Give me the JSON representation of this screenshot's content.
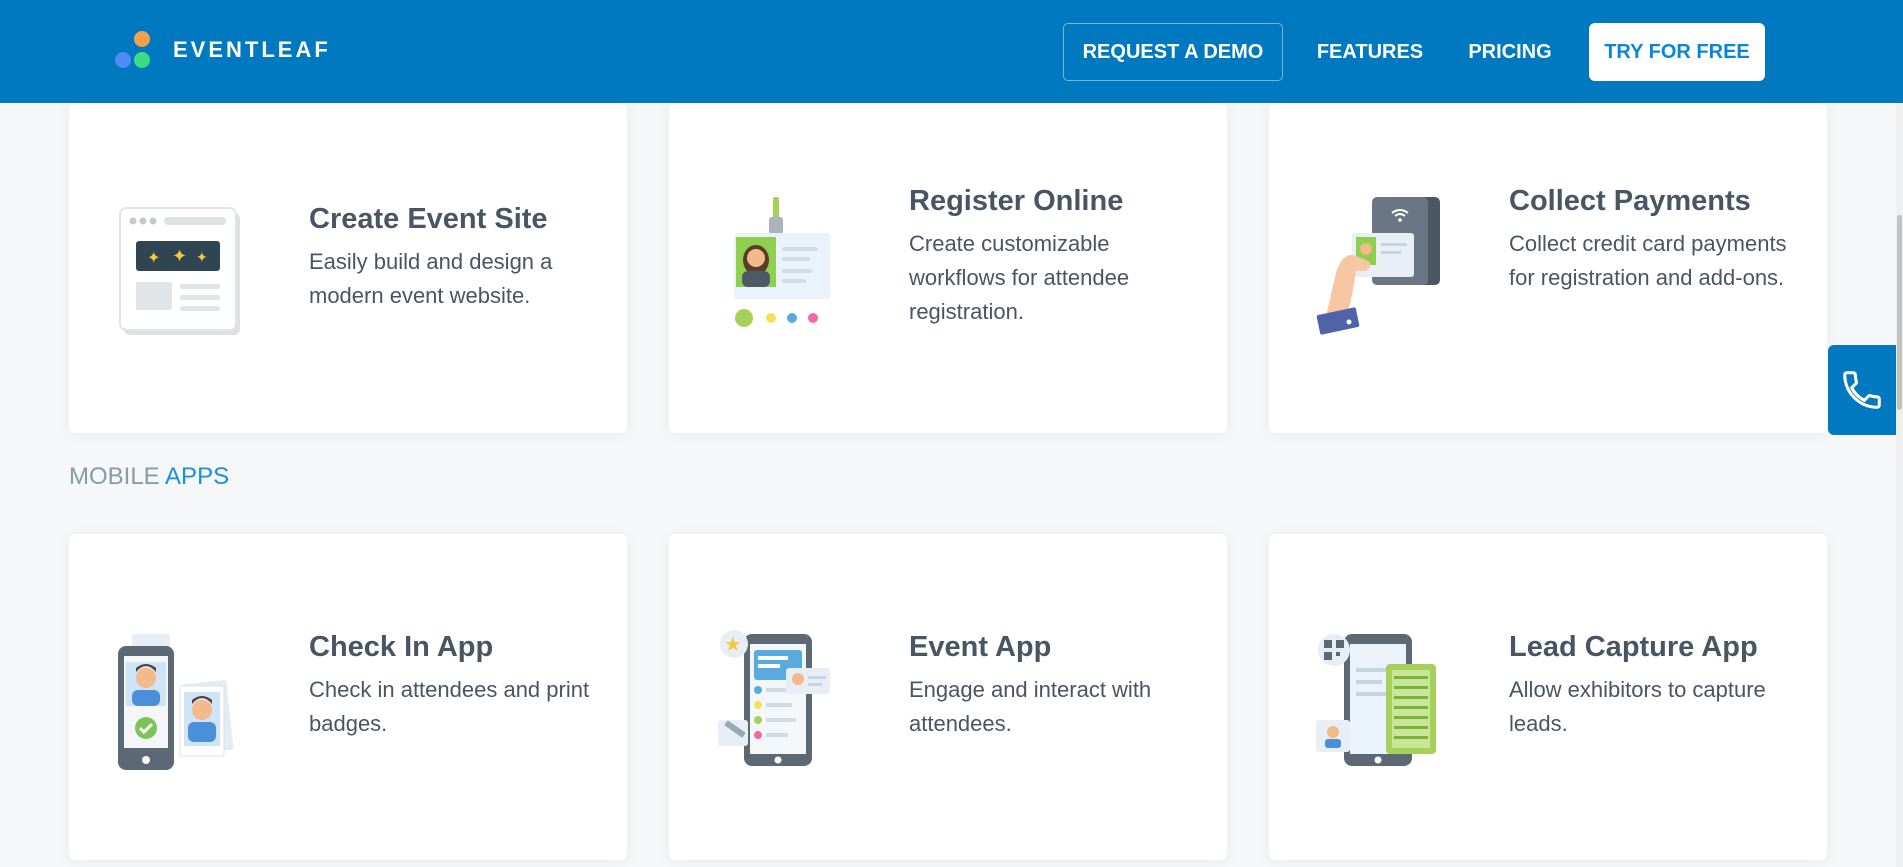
{
  "header": {
    "brand": "EVENTLEAF",
    "nav": {
      "request_demo": "REQUEST A DEMO",
      "features": "FEATURES",
      "pricing": "PRICING",
      "try_free": "TRY FOR FREE"
    }
  },
  "cards_top": [
    {
      "title": "Create Event Site",
      "description": "Easily build and design a modern event website.",
      "icon": "event-site-icon"
    },
    {
      "title": "Register Online",
      "description": "Create customizable workflows for attendee registration.",
      "icon": "badge-icon"
    },
    {
      "title": "Collect Payments",
      "description": "Collect credit card payments for registration and add-ons.",
      "icon": "payment-terminal-icon"
    }
  ],
  "section": {
    "label_a": "MOBILE",
    "label_b": "APPS"
  },
  "cards_bottom": [
    {
      "title": "Check In App",
      "description": "Check in attendees and print badges.",
      "icon": "check-in-phone-icon"
    },
    {
      "title": "Event App",
      "description": "Engage and interact with attendees.",
      "icon": "event-app-phone-icon"
    },
    {
      "title": "Lead Capture App",
      "description": "Allow exhibitors to capture leads.",
      "icon": "lead-capture-phone-icon"
    }
  ],
  "colors": {
    "header_bg": "#0079c1",
    "accent": "#1a8fe0",
    "text": "#4a5563"
  }
}
